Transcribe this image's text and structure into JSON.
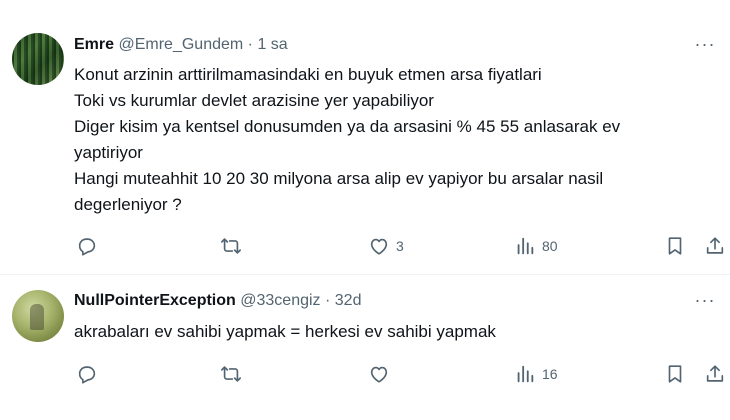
{
  "tweets": [
    {
      "name": "Emre",
      "handle": "@Emre_Gundem",
      "dot": "·",
      "time": "1 sa",
      "lines": [
        "Konut arzinin arttirilmamasindaki en buyuk etmen arsa fiyatlari",
        "Toki vs kurumlar devlet arazisine yer yapabiliyor",
        "Diger kisim ya kentsel donusumden ya da arsasini % 45 55 anlasarak ev",
        "yaptiriyor",
        "Hangi muteahhit 10 20 30 milyona arsa alip ev yapiyor bu arsalar nasil",
        "degerleniyor ?"
      ],
      "likes": "3",
      "views": "80"
    },
    {
      "name": "NullPointerException",
      "handle": "@33cengiz",
      "dot": "·",
      "time": "32d",
      "lines": [
        "akrabaları ev sahibi yapmak = herkesi ev sahibi yapmak"
      ],
      "likes": "",
      "views": "16"
    }
  ],
  "more_label": "···",
  "icons": {
    "reply": "reply-icon",
    "retweet": "retweet-icon",
    "like": "heart-icon",
    "views": "views-icon",
    "bookmark": "bookmark-icon",
    "share": "share-icon"
  },
  "colors": {
    "text_primary": "#0f1419",
    "text_secondary": "#536471",
    "divider": "#eff3f4"
  }
}
